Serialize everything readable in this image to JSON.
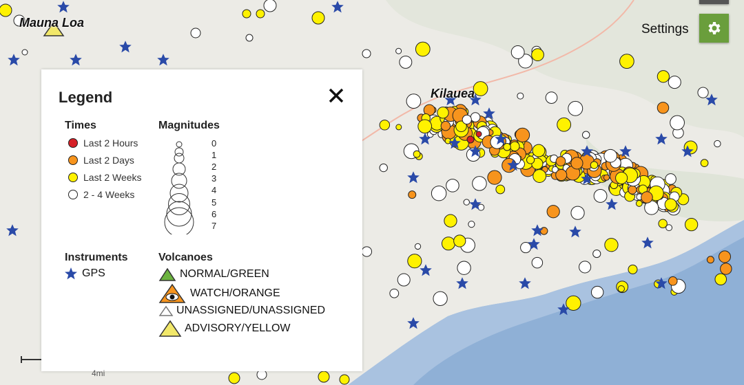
{
  "map": {
    "places": [
      {
        "name": "Mauna Loa",
        "alert": "ADVISORY/YELLOW"
      },
      {
        "name": "Kilauea",
        "alert": "WATCH/ORANGE"
      }
    ],
    "scale_label": "4mi",
    "colors": {
      "land": "#ecebe6",
      "ocean": "#8fb0d6",
      "road": "#f2b8a8",
      "gps": "#2a4aa8"
    }
  },
  "settings": {
    "label": "Settings",
    "icon": "gear-icon",
    "color": "#6a9e3c"
  },
  "legend": {
    "title": "Legend",
    "close_icon": "close-icon",
    "times": {
      "title": "Times",
      "items": [
        {
          "label": "Last 2 Hours",
          "color": "#d62027"
        },
        {
          "label": "Last 2 Days",
          "color": "#f7941d"
        },
        {
          "label": "Last 2 Weeks",
          "color": "#fff200"
        },
        {
          "label": "2 - 4 Weeks",
          "color": "#ffffff"
        }
      ]
    },
    "magnitudes": {
      "title": "Magnitudes",
      "values": [
        "0",
        "1",
        "2",
        "3",
        "4",
        "5",
        "6",
        "7"
      ]
    },
    "instruments": {
      "title": "Instruments",
      "items": [
        {
          "label": "GPS",
          "icon": "star-icon"
        }
      ]
    },
    "volcanoes": {
      "title": "Volcanoes",
      "items": [
        {
          "label": "NORMAL/GREEN",
          "color": "#6cb33f"
        },
        {
          "label": "WATCH/ORANGE",
          "color": "#f7941d"
        },
        {
          "label": "UNASSIGNED/UNASSIGNED",
          "color": "#ffffff"
        },
        {
          "label": "ADVISORY/YELLOW",
          "color": "#f2e86a"
        }
      ]
    }
  }
}
